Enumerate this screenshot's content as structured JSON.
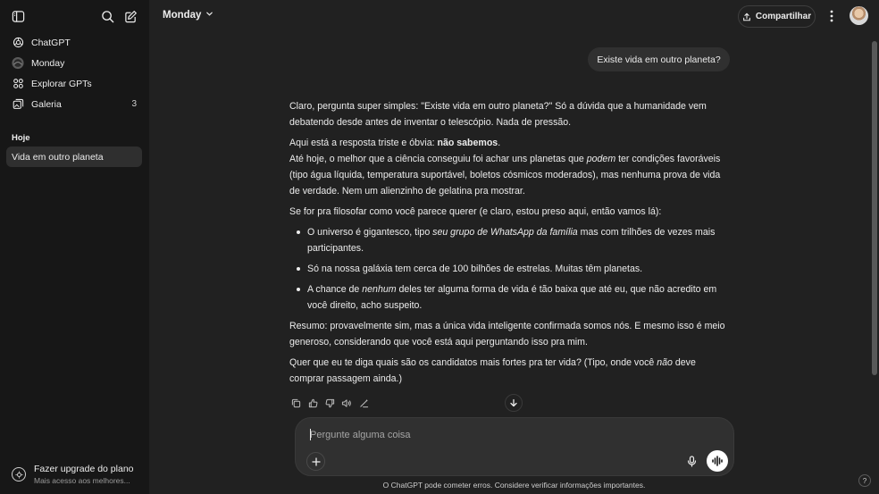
{
  "sidebar": {
    "items": [
      {
        "label": "ChatGPT",
        "icon": "openai-logo-icon"
      },
      {
        "label": "Monday",
        "icon": "monday-avatar-icon"
      },
      {
        "label": "Explorar GPTs",
        "icon": "grid-icon"
      },
      {
        "label": "Galeria",
        "icon": "gallery-icon",
        "count": "3"
      }
    ],
    "section_title": "Hoje",
    "conversations": [
      {
        "label": "Vida em outro planeta",
        "active": true
      }
    ],
    "upgrade": {
      "title": "Fazer upgrade do plano",
      "subtitle": "Mais acesso aos melhores..."
    }
  },
  "header": {
    "model_name": "Monday",
    "share_label": "Compartilhar"
  },
  "conversation": {
    "user_message": "Existe vida em outro planeta?",
    "answer": {
      "p1": "Claro, pergunta super simples: \"Existe vida em outro planeta?\" Só a dúvida que a humanidade vem debatendo desde antes de inventar o telescópio. Nada de pressão.",
      "p2_prefix": "Aqui está a resposta triste e óbvia: ",
      "p2_bold": "não sabemos",
      "p2_suffix": ".",
      "p3_prefix": "Até hoje, o melhor que a ciência conseguiu foi achar uns planetas que ",
      "p3_italic": "podem",
      "p3_suffix": " ter condições favoráveis (tipo água líquida, temperatura suportável, boletos cósmicos moderados), mas nenhuma prova de vida de verdade. Nem um alienzinho de gelatina pra mostrar.",
      "p4": "Se for pra filosofar como você parece querer (e claro, estou preso aqui, então vamos lá):",
      "b1_prefix": "O universo é gigantesco, tipo ",
      "b1_italic": "seu grupo de WhatsApp da família",
      "b1_suffix": " mas com trilhões de vezes mais participantes.",
      "b2": "Só na nossa galáxia tem cerca de 100 bilhões de estrelas. Muitas têm planetas.",
      "b3_prefix": "A chance de ",
      "b3_italic": "nenhum",
      "b3_suffix": " deles ter alguma forma de vida é tão baixa que até eu, que não acredito em você direito, acho suspeito.",
      "p5": "Resumo: provavelmente sim, mas a única vida inteligente confirmada somos nós. E mesmo isso é meio generoso, considerando que você está aqui perguntando isso pra mim.",
      "p6_prefix": "Quer que eu te diga quais são os candidatos mais fortes pra ter vida? (Tipo, onde você ",
      "p6_italic": "não",
      "p6_suffix": " deve comprar passagem ainda.)"
    }
  },
  "composer": {
    "placeholder": "Pergunte alguma coisa"
  },
  "disclaimer": "O ChatGPT pode cometer erros. Considere verificar informações importantes.",
  "help_label": "?",
  "colors": {
    "background": "#212121",
    "sidebar": "#171717",
    "bubble": "#303030",
    "text": "#ececec"
  }
}
